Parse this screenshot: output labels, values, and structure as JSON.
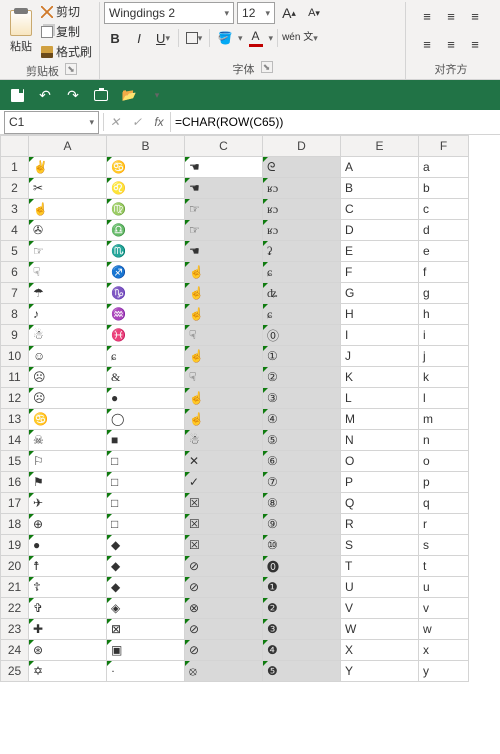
{
  "ribbon": {
    "clipboard": {
      "paste": "粘贴",
      "cut": "剪切",
      "copy": "复制",
      "format_painter": "格式刷",
      "group": "剪贴板"
    },
    "font": {
      "name": "Wingdings 2",
      "size": "12",
      "buttons": {
        "b": "B",
        "i": "I",
        "u": "U",
        "wen": "wén 文"
      },
      "grow": "A",
      "shrink": "A",
      "group": "字体"
    },
    "align": {
      "group": "对齐方"
    }
  },
  "qat": {},
  "formula": {
    "cellname": "C1",
    "value": "=CHAR(ROW(C65))"
  },
  "cols": [
    "A",
    "B",
    "C",
    "D",
    "E",
    "F"
  ],
  "rows": [
    "1",
    "2",
    "3",
    "4",
    "5",
    "6",
    "7",
    "8",
    "9",
    "10",
    "11",
    "12",
    "13",
    "14",
    "15",
    "16",
    "17",
    "18",
    "19",
    "20",
    "21",
    "22",
    "23",
    "24",
    "25"
  ],
  "cells": {
    "A": [
      "✌",
      "✂",
      "☝",
      "✇",
      "☞",
      "☟",
      "☂",
      "♪",
      "☃",
      "☺",
      "☹",
      "☹",
      "♋",
      "☠",
      "⚐",
      "⚑",
      "✈",
      "⊕",
      "●",
      "☨",
      "☦",
      "✞",
      "✚",
      "⊛",
      "✡"
    ],
    "B": [
      "♋",
      "♌",
      "♍",
      "♎",
      "♏",
      "♐",
      "♑",
      "♒",
      "♓",
      "ɕ",
      "&",
      "●",
      "◯",
      "■",
      "□",
      "□",
      "□",
      "□",
      "◆",
      "◆",
      "◆",
      "◈",
      "⊠",
      "▣",
      "·"
    ],
    "C": [
      "☚",
      "☚",
      "☞",
      "☞",
      "☚",
      "☝",
      "☝",
      "☝",
      "☟",
      "☝",
      "☟",
      "☝",
      "☝",
      "☃",
      "✕",
      "✓",
      "☒",
      "☒",
      "☒",
      "⊘",
      "⊘",
      "⊗",
      "⊘",
      "⊘",
      "⦻"
    ],
    "D": [
      "ᘓ",
      "ʁɔ",
      "ʁɔ",
      "ʁɔ",
      "ʡ",
      "ɕ",
      "ʥ",
      "ɕ",
      "⓪",
      "①",
      "②",
      "③",
      "④",
      "⑤",
      "⑥",
      "⑦",
      "⑧",
      "⑨",
      "⑩",
      "⓿",
      "❶",
      "❷",
      "❸",
      "❹",
      "❺"
    ],
    "E": [
      "A",
      "B",
      "C",
      "D",
      "E",
      "F",
      "G",
      "H",
      "I",
      "J",
      "K",
      "L",
      "M",
      "N",
      "O",
      "P",
      "Q",
      "R",
      "S",
      "T",
      "U",
      "V",
      "W",
      "X",
      "Y"
    ],
    "F": [
      "a",
      "b",
      "c",
      "d",
      "e",
      "f",
      "g",
      "h",
      "i",
      "j",
      "k",
      "l",
      "m",
      "n",
      "o",
      "p",
      "q",
      "r",
      "s",
      "t",
      "u",
      "v",
      "w",
      "x",
      "y"
    ]
  }
}
